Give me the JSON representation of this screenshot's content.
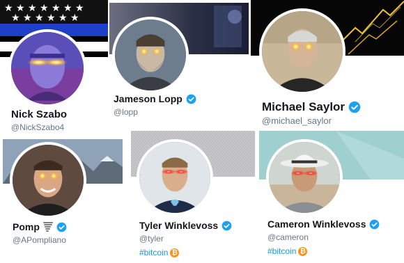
{
  "profiles": [
    {
      "name": "Nick Szabo",
      "handle": "@NickSzabo4"
    },
    {
      "name": "Jameson Lopp",
      "handle": "@lopp"
    },
    {
      "name": "Michael Saylor",
      "handle": "@michael_saylor"
    },
    {
      "name": "Pomp",
      "handle": "@APompliano"
    },
    {
      "name": "Tyler Winklevoss",
      "handle": "@tyler",
      "tag": "#bitcoin"
    },
    {
      "name": "Cameron Winklevoss",
      "handle": "@cameron",
      "tag": "#bitcoin"
    }
  ],
  "icons": {
    "verified": "verified-badge-icon",
    "tornado": "tornado-icon",
    "bitcoin": "bitcoin-icon"
  },
  "colors": {
    "verified": "#1da1f2",
    "hashtag": "#1b95e0",
    "bitcoin": "#f7931a",
    "laser": "#ffcc33"
  },
  "bitcoin_symbol": "₿"
}
